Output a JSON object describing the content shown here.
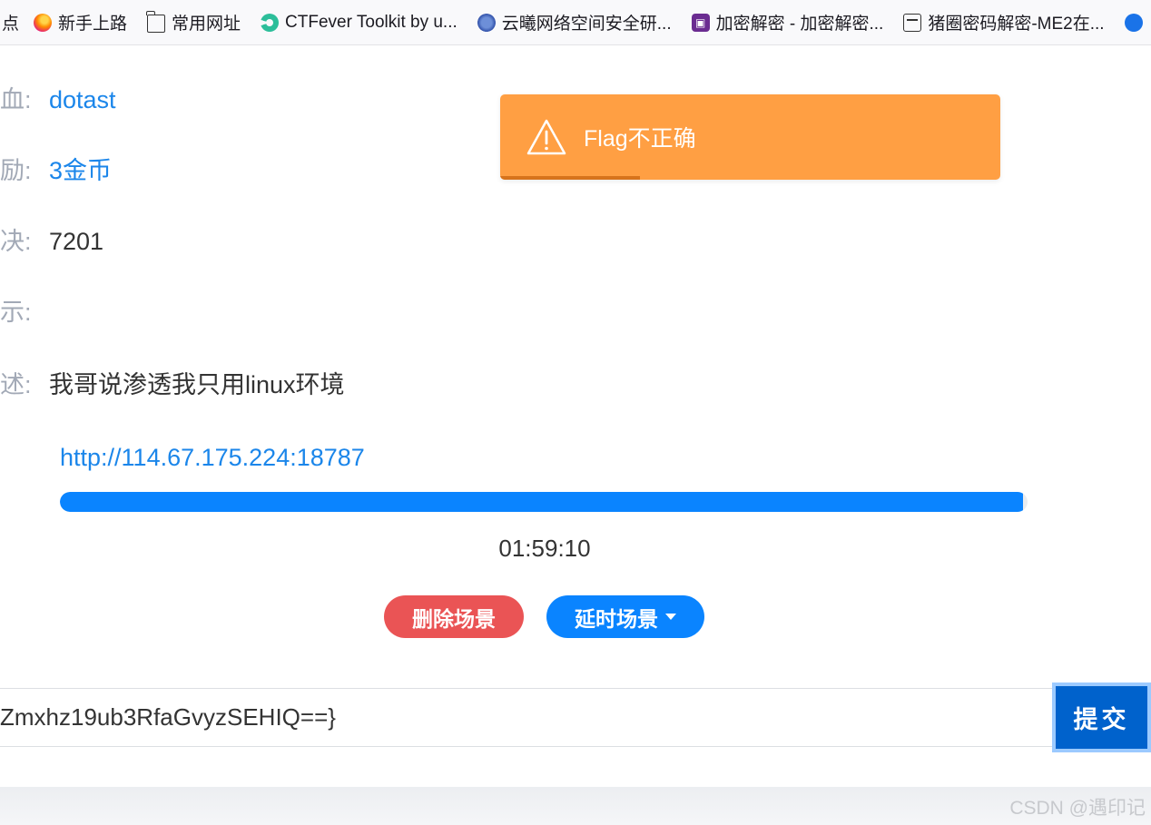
{
  "bookmarks": [
    {
      "label": "点",
      "icon": "none"
    },
    {
      "label": "新手上路",
      "icon": "firefox-icon"
    },
    {
      "label": "常用网址",
      "icon": "folder-icon"
    },
    {
      "label": "CTFever Toolkit by u...",
      "icon": "ctfever-icon"
    },
    {
      "label": "云曦网络空间安全研...",
      "icon": "yunxi-icon"
    },
    {
      "label": "加密解密 - 加密解密...",
      "icon": "crypto-icon"
    },
    {
      "label": "猪圈密码解密-ME2在...",
      "icon": "pigpen-icon"
    }
  ],
  "info_rows": [
    {
      "label": "血:",
      "value": "dotast",
      "link": true
    },
    {
      "label": "励:",
      "value": "3金币",
      "link": true
    },
    {
      "label": "决:",
      "value": "7201",
      "link": false
    },
    {
      "label": "示:",
      "value": "",
      "link": false
    },
    {
      "label": "述:",
      "value": "我哥说渗透我只用linux环境",
      "link": false
    }
  ],
  "toast": {
    "message": "Flag不正确",
    "color": "#ff9f43",
    "progress": 0.28
  },
  "scene": {
    "url": "http://114.67.175.224:18787",
    "progress": 0.995,
    "timer": "01:59:10",
    "delete_label": "删除场景",
    "delay_label": "延时场景"
  },
  "flag_form": {
    "value": "Zmxhz19ub3RfaGvyzSEHIQ==}",
    "submit_label": "提交"
  },
  "watermark": "CSDN @遇印记",
  "colors": {
    "link": "#1b86ea",
    "primary": "#0a84ff",
    "danger": "#ea5455",
    "warning": "#ff9f43"
  }
}
